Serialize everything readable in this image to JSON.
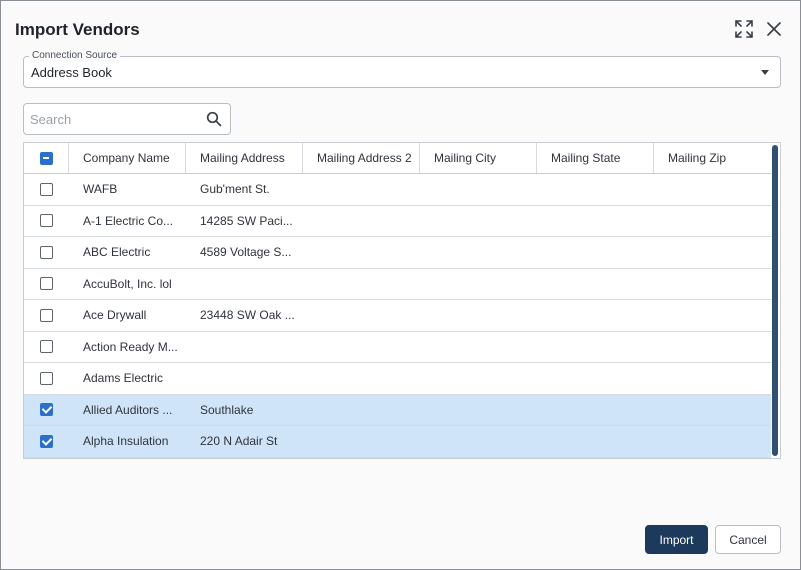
{
  "dialog": {
    "title": "Import Vendors"
  },
  "header_icons": {
    "expand": "expand-icon",
    "close": "close-icon"
  },
  "connection_source": {
    "label": "Connection Source",
    "value": "Address Book"
  },
  "search": {
    "placeholder": "Search",
    "value": ""
  },
  "table": {
    "header_checkbox_state": "indeterminate",
    "columns": [
      "Company Name",
      "Mailing Address",
      "Mailing Address 2",
      "Mailing City",
      "Mailing State",
      "Mailing Zip"
    ],
    "rows": [
      {
        "checked": false,
        "company": "WAFB",
        "address": "Gub'ment St.",
        "address2": "",
        "city": "",
        "state": "",
        "zip": ""
      },
      {
        "checked": false,
        "company": "A-1 Electric Co...",
        "address": "14285 SW Paci...",
        "address2": "",
        "city": "",
        "state": "",
        "zip": ""
      },
      {
        "checked": false,
        "company": "ABC Electric",
        "address": "4589 Voltage S...",
        "address2": "",
        "city": "",
        "state": "",
        "zip": ""
      },
      {
        "checked": false,
        "company": "AccuBolt, Inc. lol",
        "address": "",
        "address2": "",
        "city": "",
        "state": "",
        "zip": ""
      },
      {
        "checked": false,
        "company": "Ace Drywall",
        "address": "23448 SW Oak ...",
        "address2": "",
        "city": "",
        "state": "",
        "zip": ""
      },
      {
        "checked": false,
        "company": "Action Ready M...",
        "address": "",
        "address2": "",
        "city": "",
        "state": "",
        "zip": ""
      },
      {
        "checked": false,
        "company": "Adams Electric",
        "address": "",
        "address2": "",
        "city": "",
        "state": "",
        "zip": ""
      },
      {
        "checked": true,
        "company": "Allied Auditors ...",
        "address": "Southlake",
        "address2": "",
        "city": "",
        "state": "",
        "zip": ""
      },
      {
        "checked": true,
        "company": "Alpha Insulation",
        "address": "220 N Adair St",
        "address2": "",
        "city": "",
        "state": "",
        "zip": ""
      }
    ]
  },
  "buttons": {
    "import": "Import",
    "cancel": "Cancel"
  },
  "colors": {
    "primary": "#1d3a5c",
    "checkbox_accent": "#2a6fc9",
    "selected_row": "#cfe4f8"
  }
}
